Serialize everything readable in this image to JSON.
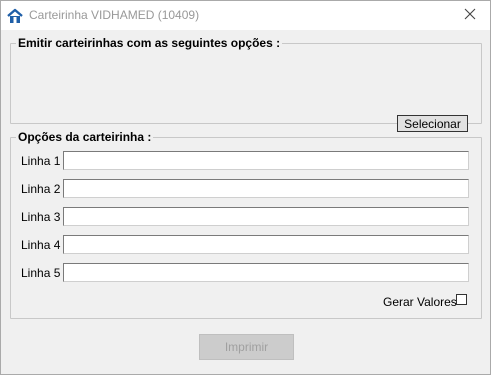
{
  "window": {
    "title": "Carteirinha VIDHAMED (10409)",
    "close_symbol": "✕"
  },
  "emit_group": {
    "legend": "Emitir carteirinhas com as seguintes opções :",
    "select_button": "Selecionar"
  },
  "options_group": {
    "legend": "Opções da carteirinha :",
    "lines": [
      {
        "label": "Linha 1",
        "value": ""
      },
      {
        "label": "Linha 2",
        "value": ""
      },
      {
        "label": "Linha 3",
        "value": ""
      },
      {
        "label": "Linha 4",
        "value": ""
      },
      {
        "label": "Linha 5",
        "value": ""
      }
    ],
    "gerar_valores_label": "Gerar Valores",
    "gerar_valores_checked": false
  },
  "footer": {
    "print_button": "Imprimir",
    "print_enabled": false
  },
  "colors": {
    "window_bg": "#f0f0f0",
    "title_text": "#999999",
    "icon_blue": "#1f5fa8"
  }
}
